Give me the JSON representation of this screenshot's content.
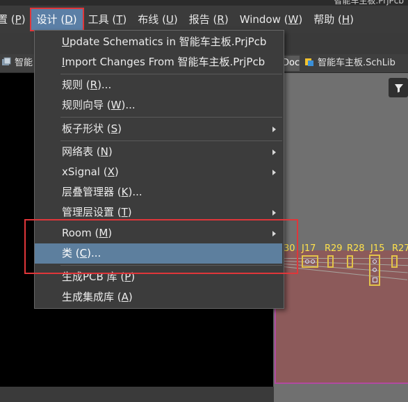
{
  "window": {
    "title": "智能车主板.PrjPcb"
  },
  "menubar": [
    {
      "id": "project",
      "pre": "置",
      "label": "置 (P)",
      "text": "置",
      "key": "P"
    },
    {
      "id": "design",
      "text": "设计",
      "key": "D"
    },
    {
      "id": "tools",
      "text": "工具",
      "key": "T"
    },
    {
      "id": "route",
      "text": "布线",
      "key": "U"
    },
    {
      "id": "reports",
      "text": "报告",
      "key": "R"
    },
    {
      "id": "window",
      "text": "Window",
      "key": "W"
    },
    {
      "id": "help",
      "text": "帮助",
      "key": "H"
    }
  ],
  "tabs": {
    "left": "智能",
    "doc": "Doc",
    "schlib": "智能车主板.SchLib"
  },
  "design_menu": [
    {
      "name": "update-schematics",
      "pre": "",
      "ak": "U",
      "post": "pdate Schematics in 智能车主板.PrjPcb",
      "submenu": false
    },
    {
      "name": "import-changes",
      "pre": "",
      "ak": "I",
      "post": "mport Changes From 智能车主板.PrjPcb",
      "submenu": false
    },
    {
      "name": "rules",
      "pre": "规则 (",
      "ak": "R",
      "post": ")...",
      "submenu": false
    },
    {
      "name": "rule-wizard",
      "pre": "规则向导 (",
      "ak": "W",
      "post": ")...",
      "submenu": false
    },
    {
      "name": "board-shape",
      "pre": "板子形状 (",
      "ak": "S",
      "post": ")",
      "submenu": true
    },
    {
      "name": "netlist",
      "pre": "网络表 (",
      "ak": "N",
      "post": ")",
      "submenu": true
    },
    {
      "name": "xsignal",
      "pre": "xSignal (",
      "ak": "X",
      "post": ")",
      "submenu": true
    },
    {
      "name": "layer-stack",
      "pre": "层叠管理器 (",
      "ak": "K",
      "post": ")...",
      "submenu": false
    },
    {
      "name": "mechanical-layers",
      "pre": "管理层设置 (",
      "ak": "T",
      "post": ")",
      "submenu": true
    },
    {
      "name": "room",
      "pre": "Room (",
      "ak": "M",
      "post": ")",
      "submenu": true
    },
    {
      "name": "classes",
      "pre": "类 (",
      "ak": "C",
      "post": ")...",
      "submenu": false
    },
    {
      "name": "make-pcb-library",
      "pre": "生成PCB 库 (",
      "ak": "P",
      "post": ")",
      "submenu": false
    },
    {
      "name": "make-integrated-library",
      "pre": "生成集成库 (",
      "ak": "A",
      "post": ")",
      "submenu": false
    }
  ],
  "pcb": {
    "labels": [
      "30",
      "J17",
      "R29",
      "R28",
      "J15",
      "R27"
    ]
  },
  "colors": {
    "menu_highlight": "#5d7f9e",
    "annotation_red": "#e0363a",
    "silkscreen": "#ffe14b"
  }
}
